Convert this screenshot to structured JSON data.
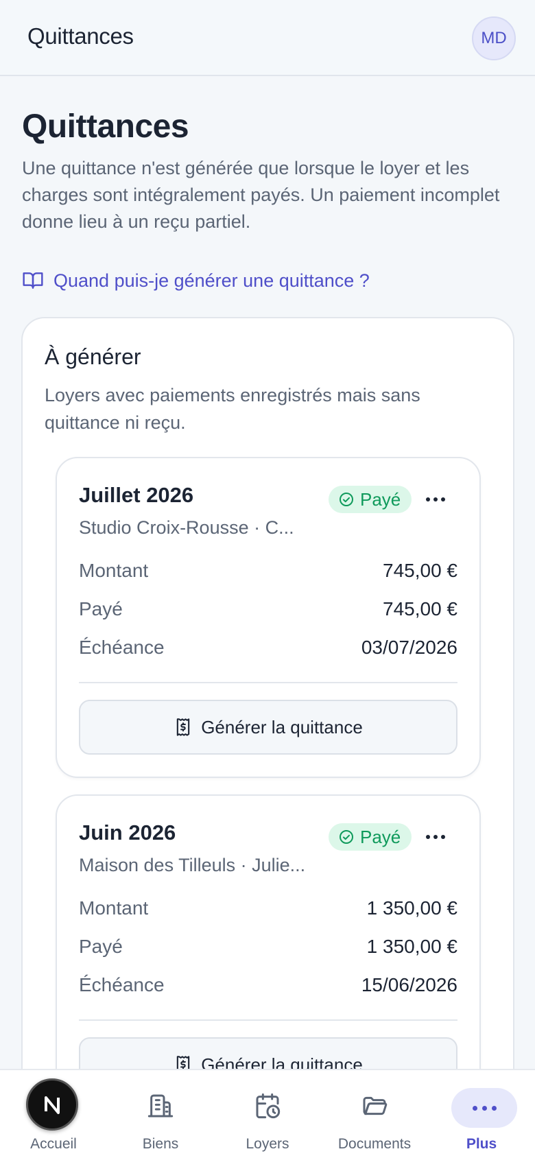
{
  "header": {
    "title": "Quittances",
    "avatar_initials": "MD"
  },
  "page": {
    "title": "Quittances",
    "description": "Une quittance n'est générée que lorsque le loyer et les charges sont intégralement payés. Un paiement incomplet donne lieu à un reçu partiel.",
    "help_link": "Quand puis-je générer une quittance ?",
    "help_icon": "book-open-icon"
  },
  "section": {
    "title": "À générer",
    "description": "Loyers avec paiements enregistrés mais sans quittance ni reçu.",
    "cards": [
      {
        "title": "Juillet 2026",
        "subtitle": "Studio Croix-Rousse · C...",
        "status": "Payé",
        "amount_label": "Montant",
        "amount": "745,00 €",
        "paid_label": "Payé",
        "paid": "745,00 €",
        "due_label": "Échéance",
        "due": "03/07/2026",
        "action": "Générer la quittance"
      },
      {
        "title": "Juin 2026",
        "subtitle": "Maison des Tilleuls · Julie...",
        "status": "Payé",
        "amount_label": "Montant",
        "amount": "1 350,00 €",
        "paid_label": "Payé",
        "paid": "1 350,00 €",
        "due_label": "Échéance",
        "due": "15/06/2026",
        "action": "Générer la quittance"
      }
    ]
  },
  "nav": {
    "items": [
      {
        "label": "Accueil",
        "icon": "home-icon"
      },
      {
        "label": "Biens",
        "icon": "building-icon"
      },
      {
        "label": "Loyers",
        "icon": "calendar-clock-icon"
      },
      {
        "label": "Documents",
        "icon": "folder-icon"
      },
      {
        "label": "Plus",
        "icon": "more-horizontal-icon"
      }
    ],
    "active_index": 4
  },
  "colors": {
    "accent": "#4f4fc9",
    "success": "#0f9a5b",
    "success_bg": "#dcf7e9"
  }
}
